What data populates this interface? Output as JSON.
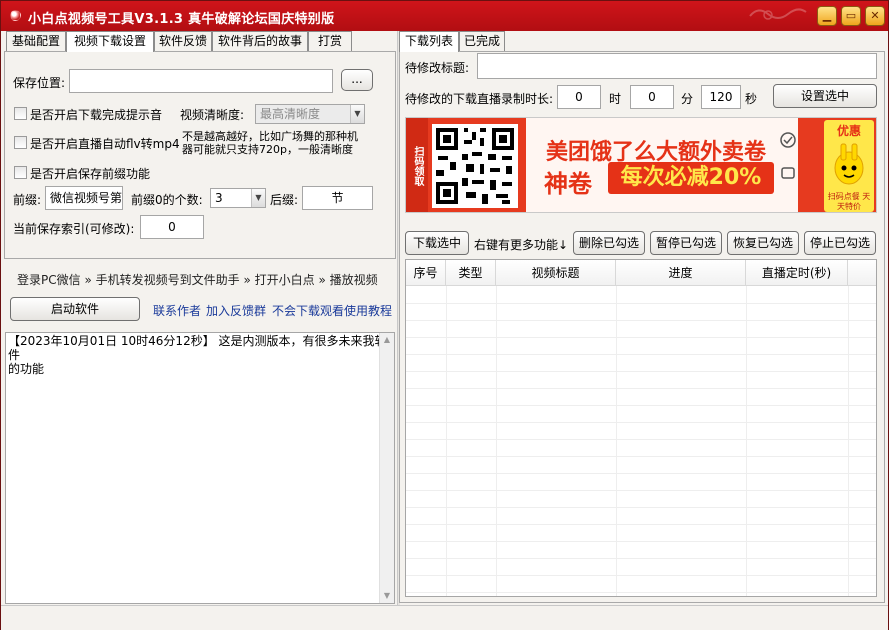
{
  "window": {
    "title": "小白点视频号工具V3.1.3 真牛破解论坛国庆特别版",
    "buttons": {
      "minimize": "▁",
      "maximize": "▭",
      "close": "✕"
    }
  },
  "left_tabs": [
    "基础配置",
    "视频下载设置",
    "软件反馈",
    "软件背后的故事",
    "打赏"
  ],
  "left_active_tab": 1,
  "settings": {
    "save_path_label": "保存位置:",
    "save_path_value": "",
    "browse_label": "...",
    "notify_sound_label": "是否开启下载完成提示音",
    "clarity_label": "视频清晰度:",
    "clarity_value": "最高清晰度",
    "flv_to_mp4_label": "是否开启直播自动flv转mp4",
    "clarity_note_line1": "不是越高越好，比如广场舞的那种机",
    "clarity_note_line2": "器可能就只支持720p，一般清晰度",
    "prefix_enable_label": "是否开启保存前缀功能",
    "prefix_label": "前缀:",
    "prefix_value": "微信视频号第",
    "zero_count_label": "前缀0的个数:",
    "zero_count_value": "3",
    "suffix_label": "后缀:",
    "suffix_value": "节",
    "current_index_label": "当前保存索引(可修改):",
    "current_index_value": "0"
  },
  "guide": {
    "step1": "登录PC微信",
    "step2": "手机转发视频号到文件助手",
    "step3": "打开小白点",
    "step4": "播放视频",
    "sep": "»"
  },
  "launch_button": "启动软件",
  "links": {
    "contact": "联系作者",
    "group": "加入反馈群",
    "tutorial": "不会下载观看使用教程"
  },
  "log": {
    "line1": "【2023年10月01日 10时46分12秒】 这是内测版本，有很多未来我软件",
    "line2": "的功能"
  },
  "right_tabs": [
    "下载列表",
    "已完成"
  ],
  "right_active_tab": 0,
  "edit": {
    "title_label": "待修改标题:",
    "title_value": "",
    "record_label": "待修改的下载直播录制时长:",
    "hours_value": "0",
    "hours_unit": "时",
    "minutes_value": "0",
    "minutes_unit": "分",
    "seconds_value": "120",
    "seconds_unit": "秒",
    "apply_button": "设置选中"
  },
  "ad": {
    "side_text": "扫码领取",
    "headline1": "美团饿了么大额外卖卷",
    "headline2_a": "神卷",
    "headline2_b": "每次必减20%",
    "badge": "优惠",
    "badge_sub": "扫码点餐 天天特价"
  },
  "actions": {
    "download_selected": "下载选中",
    "more_hint": "右键有更多功能↓",
    "delete_checked": "删除已勾选",
    "pause_checked": "暂停已勾选",
    "resume_checked": "恢复已勾选",
    "stop_checked": "停止已勾选"
  },
  "table": {
    "columns": [
      "序号",
      "类型",
      "视频标题",
      "进度",
      "直播定时(秒)"
    ],
    "rows": []
  },
  "colors": {
    "titlebar": "#c8121a",
    "ad_red": "#e63a1f",
    "ad_yellow": "#ffe74a",
    "link": "#1a3a9a"
  }
}
